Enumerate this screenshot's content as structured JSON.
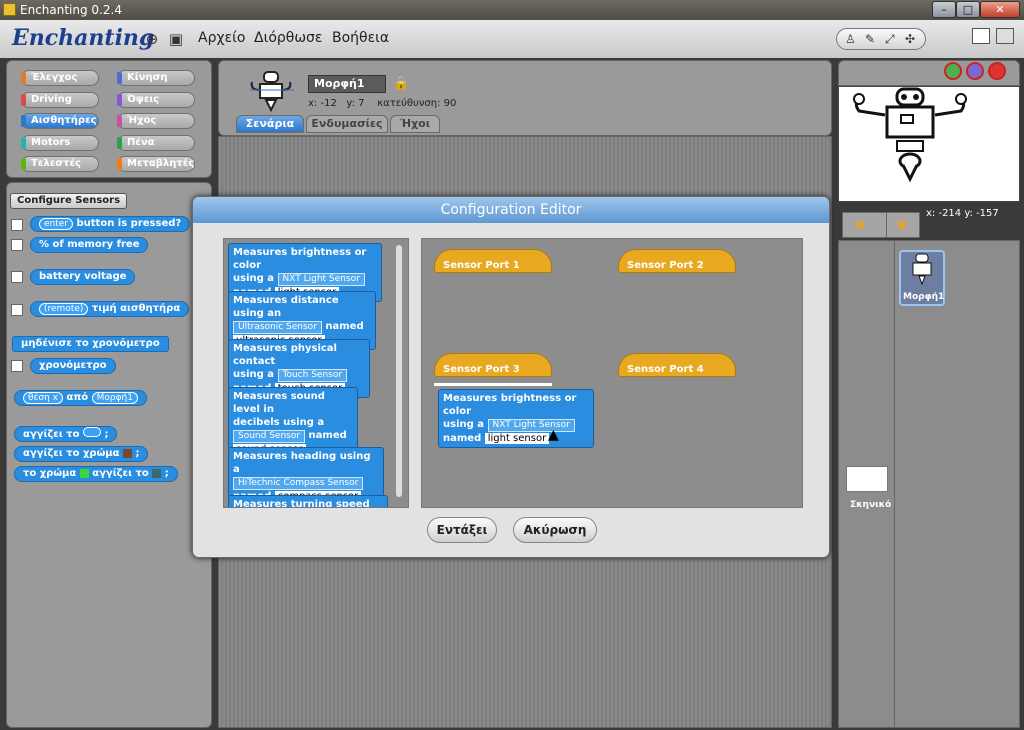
{
  "window": {
    "title": "Enchanting 0.2.4",
    "buttons": [
      "–",
      "□",
      "✕"
    ]
  },
  "menubar": {
    "logo": "Enchanting",
    "menus": [
      "Αρχείο",
      "Διόρθωσε",
      "Βοήθεια"
    ]
  },
  "categories": [
    {
      "label": "Έλεγχος",
      "color": "#e07b2b"
    },
    {
      "label": "Κίνηση",
      "color": "#4a6cd4"
    },
    {
      "label": "Driving",
      "color": "#d94a4a"
    },
    {
      "label": "Όψεις",
      "color": "#8a55d7"
    },
    {
      "label": "Αισθητήρες",
      "color": "#2f78c8",
      "active": true
    },
    {
      "label": "Ήχος",
      "color": "#c7509f"
    },
    {
      "label": "Motors",
      "color": "#2bb0b0"
    },
    {
      "label": "Πένα",
      "color": "#2aa150"
    },
    {
      "label": "Τελεστές",
      "color": "#5cb712"
    },
    {
      "label": "Μεταβλητές",
      "color": "#ee7d16"
    }
  ],
  "palette": {
    "configure_button": "Configure Sensors",
    "enter_dd": "enter",
    "button_pressed": "button is pressed?",
    "memory_free": "% of memory free",
    "battery": "battery voltage",
    "remote_dd": "(remote)",
    "sensor_value": "τιμή αισθητήρα",
    "reset_timer": "μηδένισε το χρονόμετρο",
    "timer": "χρονόμετρο",
    "pos_dd": "θέση x",
    "apo": "από",
    "sprite_dd": "Μορφή1",
    "touching": "αγγίζει το",
    "touching_color": "αγγίζει το χρώμα",
    "color_touching_a": "το χρώμα",
    "color_touching_b": "αγγίζει το",
    "q": ";"
  },
  "sprite": {
    "name": "Μορφή1",
    "x_label": "x:",
    "x": "-12",
    "y_label": "y:",
    "y": "7",
    "dir_label": "κατεύθυνση:",
    "dir": "90"
  },
  "tabs": [
    "Σενάρια",
    "Ενδυμασίες",
    "Ήχοι"
  ],
  "stage": {
    "coords": "x: -214  y: -157",
    "sprite_label": "Μορφή1",
    "stage_label": "Σκηνικό"
  },
  "dialog": {
    "title": "Configuration Editor",
    "blocks": [
      {
        "text1": "Measures brightness or color",
        "text2": "using a",
        "dd": "NXT Light Sensor",
        "named": "named",
        "field": "light sensor",
        "tail": "."
      },
      {
        "text1": "Measures distance using an",
        "dd": "Ultrasonic Sensor",
        "named": "named",
        "field": "ultrasonic sensor"
      },
      {
        "text1": "Measures physical contact",
        "text2": "using a",
        "dd": "Touch Sensor",
        "named": "named",
        "field": "touch sensor"
      },
      {
        "text1": "Measures sound level in",
        "text2": "decibels using a",
        "dd": "Sound Sensor",
        "named": "named",
        "field": "sound sensor"
      },
      {
        "text1": "Measures heading using a",
        "dd": "HiTechnic Compass Sensor",
        "named": "named",
        "field": "compass sensor"
      },
      {
        "text1": "Measures turning speed using"
      }
    ],
    "ports": [
      "Sensor Port 1",
      "Sensor Port 2",
      "Sensor Port 3",
      "Sensor Port 4"
    ],
    "attached": {
      "text1": "Measures brightness or color",
      "text2": "using a",
      "dd": "NXT Light Sensor",
      "named": "named",
      "field": "light sensor"
    },
    "ok": "Εντάξει",
    "cancel": "Ακύρωση"
  }
}
